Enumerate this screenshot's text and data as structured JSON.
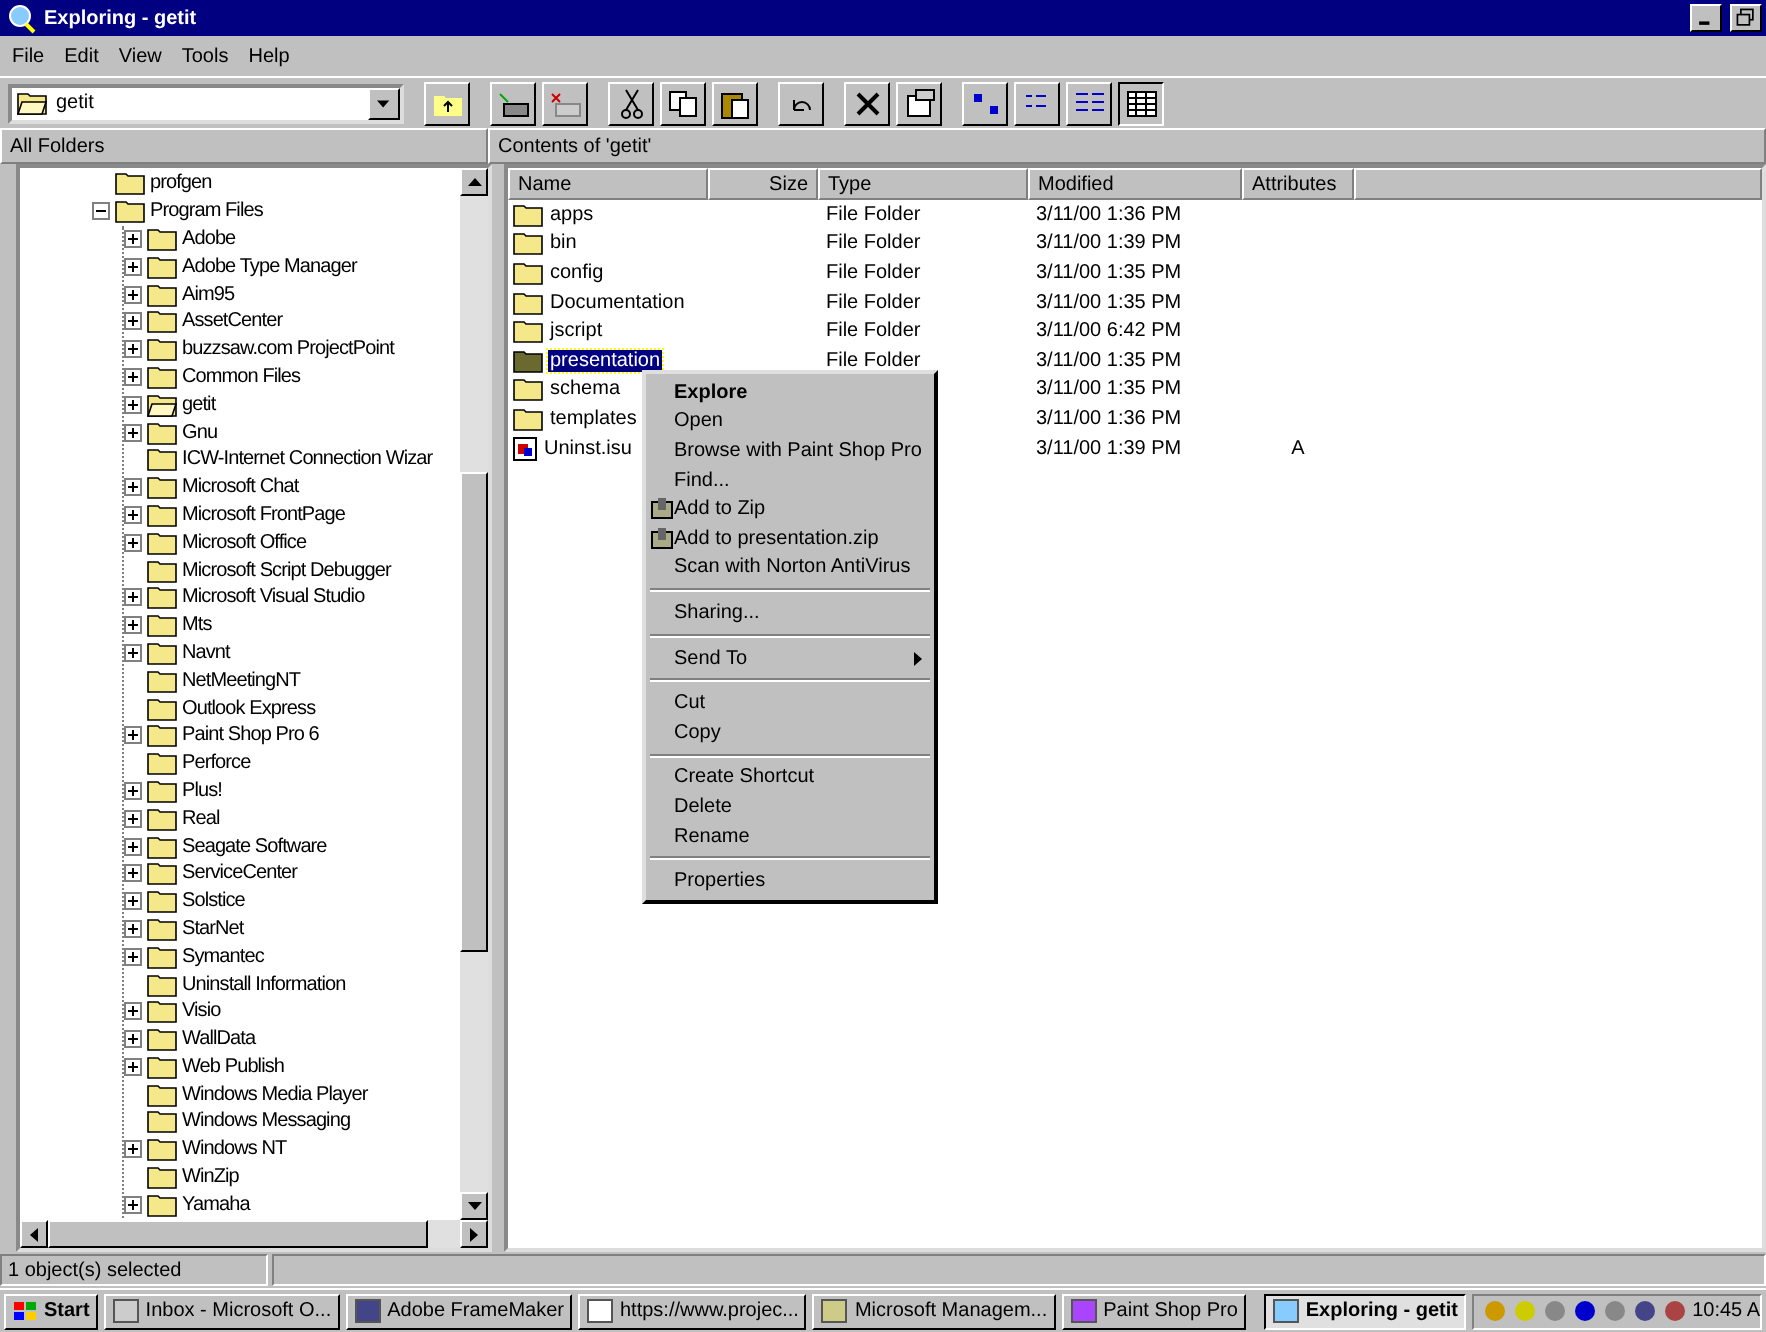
{
  "window": {
    "title": "Exploring - getit"
  },
  "menu": [
    "File",
    "Edit",
    "View",
    "Tools",
    "Help"
  ],
  "toolbar": {
    "address": "getit"
  },
  "left_pane": {
    "title": "All Folders",
    "tree": [
      {
        "label": "profgen",
        "expandable": false,
        "open": false
      },
      {
        "label": "Program Files",
        "expandable": true,
        "expanded": true,
        "open": false,
        "children": [
          {
            "label": "Adobe",
            "expandable": true,
            "expanded": false,
            "open": false
          },
          {
            "label": "Adobe Type Manager",
            "expandable": true,
            "expanded": false,
            "open": false
          },
          {
            "label": "Aim95",
            "expandable": true,
            "expanded": false,
            "open": false
          },
          {
            "label": "AssetCenter",
            "expandable": true,
            "expanded": false,
            "open": false
          },
          {
            "label": "buzzsaw.com ProjectPoint",
            "expandable": true,
            "expanded": false,
            "open": false
          },
          {
            "label": "Common Files",
            "expandable": true,
            "expanded": false,
            "open": false
          },
          {
            "label": "getit",
            "expandable": true,
            "expanded": false,
            "open": true
          },
          {
            "label": "Gnu",
            "expandable": true,
            "expanded": false,
            "open": false
          },
          {
            "label": "ICW-Internet Connection Wizar",
            "expandable": false,
            "open": false
          },
          {
            "label": "Microsoft Chat",
            "expandable": true,
            "expanded": false,
            "open": false
          },
          {
            "label": "Microsoft FrontPage",
            "expandable": true,
            "expanded": false,
            "open": false
          },
          {
            "label": "Microsoft Office",
            "expandable": true,
            "expanded": false,
            "open": false
          },
          {
            "label": "Microsoft Script Debugger",
            "expandable": false,
            "open": false
          },
          {
            "label": "Microsoft Visual Studio",
            "expandable": true,
            "expanded": false,
            "open": false
          },
          {
            "label": "Mts",
            "expandable": true,
            "expanded": false,
            "open": false
          },
          {
            "label": "Navnt",
            "expandable": true,
            "expanded": false,
            "open": false
          },
          {
            "label": "NetMeetingNT",
            "expandable": false,
            "open": false
          },
          {
            "label": "Outlook Express",
            "expandable": false,
            "open": false
          },
          {
            "label": "Paint Shop Pro 6",
            "expandable": true,
            "expanded": false,
            "open": false
          },
          {
            "label": "Perforce",
            "expandable": false,
            "open": false
          },
          {
            "label": "Plus!",
            "expandable": true,
            "expanded": false,
            "open": false
          },
          {
            "label": "Real",
            "expandable": true,
            "expanded": false,
            "open": false
          },
          {
            "label": "Seagate Software",
            "expandable": true,
            "expanded": false,
            "open": false
          },
          {
            "label": "ServiceCenter",
            "expandable": true,
            "expanded": false,
            "open": false
          },
          {
            "label": "Solstice",
            "expandable": true,
            "expanded": false,
            "open": false
          },
          {
            "label": "StarNet",
            "expandable": true,
            "expanded": false,
            "open": false
          },
          {
            "label": "Symantec",
            "expandable": true,
            "expanded": false,
            "open": false
          },
          {
            "label": "Uninstall Information",
            "expandable": false,
            "open": false
          },
          {
            "label": "Visio",
            "expandable": true,
            "expanded": false,
            "open": false
          },
          {
            "label": "WallData",
            "expandable": true,
            "expanded": false,
            "open": false
          },
          {
            "label": "Web Publish",
            "expandable": true,
            "expanded": false,
            "open": false
          },
          {
            "label": "Windows Media Player",
            "expandable": false,
            "open": false
          },
          {
            "label": "Windows Messaging",
            "expandable": false,
            "open": false
          },
          {
            "label": "Windows NT",
            "expandable": true,
            "expanded": false,
            "open": false
          },
          {
            "label": "WinZip",
            "expandable": false,
            "open": false
          },
          {
            "label": "Yamaha",
            "expandable": true,
            "expanded": false,
            "open": false
          }
        ]
      }
    ]
  },
  "right_pane": {
    "title": "Contents of 'getit'",
    "columns": [
      "Name",
      "Size",
      "Type",
      "Modified",
      "Attributes"
    ],
    "rows": [
      {
        "name": "apps",
        "kind": "folder",
        "type": "File Folder",
        "modified": "3/11/00 1:36 PM",
        "selected": false
      },
      {
        "name": "bin",
        "kind": "folder",
        "type": "File Folder",
        "modified": "3/11/00 1:39 PM",
        "selected": false
      },
      {
        "name": "config",
        "kind": "folder",
        "type": "File Folder",
        "modified": "3/11/00 1:35 PM",
        "selected": false
      },
      {
        "name": "Documentation",
        "kind": "folder",
        "type": "File Folder",
        "modified": "3/11/00 1:35 PM",
        "selected": false
      },
      {
        "name": "jscript",
        "kind": "folder",
        "type": "File Folder",
        "modified": "3/11/00 6:42 PM",
        "selected": false
      },
      {
        "name": "presentation",
        "kind": "folder",
        "type": "File Folder",
        "modified": "3/11/00 1:35 PM",
        "selected": true
      },
      {
        "name": "schema",
        "kind": "folder",
        "modified": "3/11/00 1:35 PM",
        "selected": false
      },
      {
        "name": "templates",
        "kind": "folder",
        "modified": "3/11/00 1:36 PM",
        "selected": false
      },
      {
        "name": "Uninst.isu",
        "kind": "file",
        "modified": "3/11/00 1:39 PM",
        "attributes": "A",
        "selected": false
      }
    ]
  },
  "context_menu": {
    "items": [
      {
        "kind": "default",
        "label": "Explore"
      },
      {
        "kind": "item",
        "label": "Open"
      },
      {
        "kind": "item",
        "label": "Browse with Paint Shop Pro"
      },
      {
        "kind": "item",
        "label": "Find..."
      },
      {
        "kind": "zip",
        "label": "Add to Zip"
      },
      {
        "kind": "zip",
        "label": "Add to presentation.zip"
      },
      {
        "kind": "item",
        "label": "Scan with Norton AntiVirus"
      },
      {
        "kind": "separator"
      },
      {
        "kind": "item",
        "label": "Sharing..."
      },
      {
        "kind": "separator"
      },
      {
        "kind": "submenu",
        "label": "Send To"
      },
      {
        "kind": "separator"
      },
      {
        "kind": "item",
        "label": "Cut"
      },
      {
        "kind": "item",
        "label": "Copy"
      },
      {
        "kind": "separator"
      },
      {
        "kind": "item",
        "label": "Create Shortcut"
      },
      {
        "kind": "item",
        "label": "Delete"
      },
      {
        "kind": "item",
        "label": "Rename"
      },
      {
        "kind": "separator"
      },
      {
        "kind": "item",
        "label": "Properties"
      }
    ]
  },
  "status_bar": {
    "text": "1 object(s) selected"
  },
  "taskbar": {
    "start": "Start",
    "buttons": [
      {
        "label": "Inbox - Microsoft O...",
        "selected": false
      },
      {
        "label": "Adobe FrameMaker",
        "selected": false
      },
      {
        "label": "https://www.projec...",
        "selected": false
      },
      {
        "label": "Microsoft Managem...",
        "selected": false
      },
      {
        "label": "Paint Shop Pro",
        "selected": false
      },
      {
        "label": "Exploring - getit",
        "selected": true
      }
    ],
    "clock": "10:45 A"
  }
}
